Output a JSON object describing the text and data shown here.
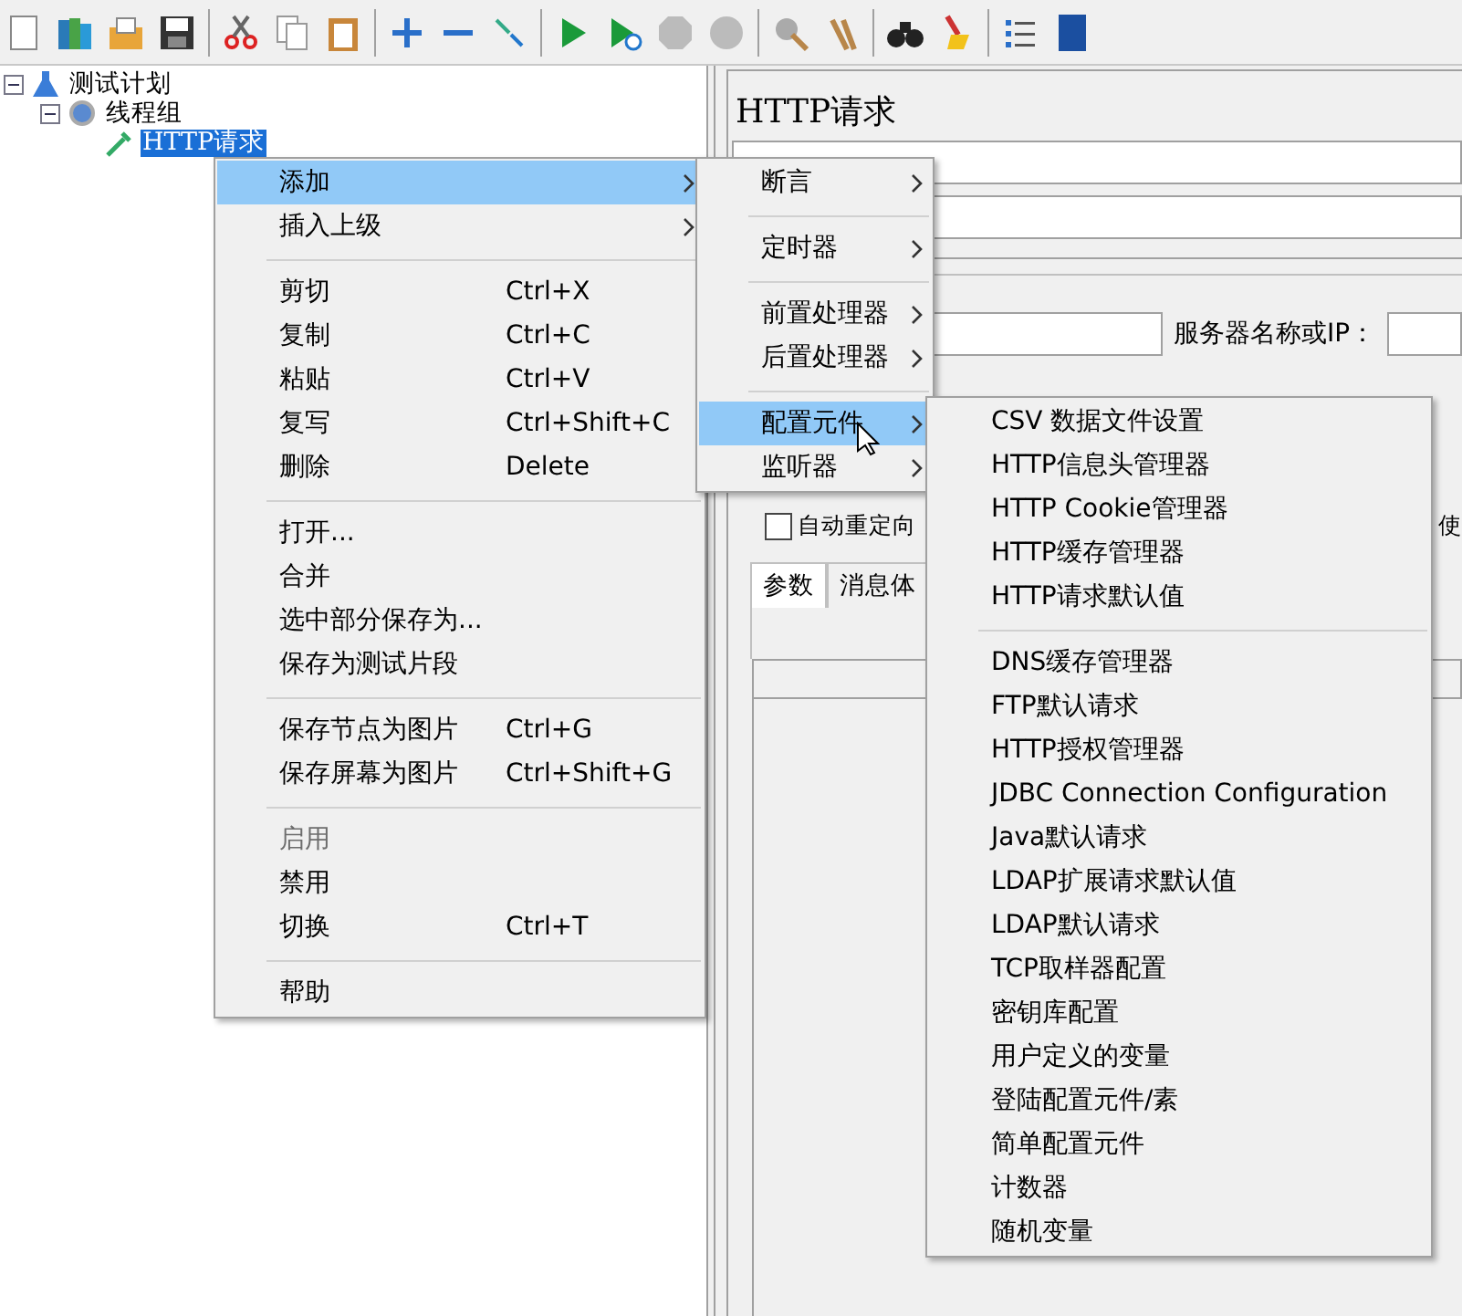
{
  "tree": [
    {
      "label": "测试计划",
      "expanded": true,
      "selected": false,
      "children": [
        {
          "label": "线程组",
          "expanded": true,
          "selected": false,
          "children": [
            {
              "label": "HTTP请求",
              "selected": true
            }
          ]
        }
      ]
    }
  ],
  "panel": {
    "title": "HTTP请求",
    "server_label": "服务器名称或IP：",
    "redirect": {
      "label": "自动重定向",
      "checked": false
    },
    "cut_label": "使",
    "tabs": [
      {
        "label": "参数",
        "selected": true
      },
      {
        "label": "消息体",
        "selected": false
      }
    ]
  },
  "context_menu": [
    {
      "kind": "item",
      "label": "添加",
      "submenu": true,
      "selected": true,
      "disabled": false
    },
    {
      "kind": "item",
      "label": "插入上级",
      "submenu": true,
      "selected": false,
      "disabled": false
    },
    {
      "kind": "separator"
    },
    {
      "kind": "item",
      "label": "剪切",
      "shortcut": "Ctrl+X",
      "selected": false,
      "disabled": false
    },
    {
      "kind": "item",
      "label": "复制",
      "shortcut": "Ctrl+C",
      "selected": false,
      "disabled": false
    },
    {
      "kind": "item",
      "label": "粘贴",
      "shortcut": "Ctrl+V",
      "selected": false,
      "disabled": false
    },
    {
      "kind": "item",
      "label": "复写",
      "shortcut": "Ctrl+Shift+C",
      "selected": false,
      "disabled": false
    },
    {
      "kind": "item",
      "label": "删除",
      "shortcut": "Delete",
      "selected": false,
      "disabled": false
    },
    {
      "kind": "separator"
    },
    {
      "kind": "item",
      "label": "打开...",
      "selected": false,
      "disabled": false
    },
    {
      "kind": "item",
      "label": "合并",
      "selected": false,
      "disabled": false
    },
    {
      "kind": "item",
      "label": "选中部分保存为...",
      "selected": false,
      "disabled": false
    },
    {
      "kind": "item",
      "label": "保存为测试片段",
      "selected": false,
      "disabled": false
    },
    {
      "kind": "separator"
    },
    {
      "kind": "item",
      "label": "保存节点为图片",
      "shortcut": "Ctrl+G",
      "selected": false,
      "disabled": false
    },
    {
      "kind": "item",
      "label": "保存屏幕为图片",
      "shortcut": "Ctrl+Shift+G",
      "selected": false,
      "disabled": false
    },
    {
      "kind": "separator"
    },
    {
      "kind": "item",
      "label": "启用",
      "selected": false,
      "disabled": true
    },
    {
      "kind": "item",
      "label": "禁用",
      "selected": false,
      "disabled": false
    },
    {
      "kind": "item",
      "label": "切换",
      "shortcut": "Ctrl+T",
      "selected": false,
      "disabled": false
    },
    {
      "kind": "separator"
    },
    {
      "kind": "item",
      "label": "帮助",
      "selected": false,
      "disabled": false
    }
  ],
  "add_submenu": [
    {
      "kind": "item",
      "label": "断言",
      "submenu": true,
      "selected": false
    },
    {
      "kind": "separator"
    },
    {
      "kind": "item",
      "label": "定时器",
      "submenu": true,
      "selected": false
    },
    {
      "kind": "separator"
    },
    {
      "kind": "item",
      "label": "前置处理器",
      "submenu": true,
      "selected": false
    },
    {
      "kind": "item",
      "label": "后置处理器",
      "submenu": true,
      "selected": false
    },
    {
      "kind": "separator"
    },
    {
      "kind": "item",
      "label": "配置元件",
      "submenu": true,
      "selected": true
    },
    {
      "kind": "item",
      "label": "监听器",
      "submenu": true,
      "selected": false
    }
  ],
  "config_submenu": [
    {
      "kind": "item",
      "label": "CSV 数据文件设置",
      "selected": false
    },
    {
      "kind": "item",
      "label": "HTTP信息头管理器",
      "selected": false
    },
    {
      "kind": "item",
      "label": "HTTP Cookie管理器",
      "selected": false
    },
    {
      "kind": "item",
      "label": "HTTP缓存管理器",
      "selected": false
    },
    {
      "kind": "item",
      "label": "HTTP请求默认值",
      "selected": false
    },
    {
      "kind": "separator"
    },
    {
      "kind": "item",
      "label": "DNS缓存管理器",
      "selected": false
    },
    {
      "kind": "item",
      "label": "FTP默认请求",
      "selected": false
    },
    {
      "kind": "item",
      "label": "HTTP授权管理器",
      "selected": false
    },
    {
      "kind": "item",
      "label": "JDBC Connection Configuration",
      "selected": false
    },
    {
      "kind": "item",
      "label": "Java默认请求",
      "selected": false
    },
    {
      "kind": "item",
      "label": "LDAP扩展请求默认值",
      "selected": false
    },
    {
      "kind": "item",
      "label": "LDAP默认请求",
      "selected": false
    },
    {
      "kind": "item",
      "label": "TCP取样器配置",
      "selected": false
    },
    {
      "kind": "item",
      "label": "密钥库配置",
      "selected": false
    },
    {
      "kind": "item",
      "label": "用户定义的变量",
      "selected": false
    },
    {
      "kind": "item",
      "label": "登陆配置元件/素",
      "selected": false
    },
    {
      "kind": "item",
      "label": "简单配置元件",
      "selected": false
    },
    {
      "kind": "item",
      "label": "计数器",
      "selected": false
    },
    {
      "kind": "item",
      "label": "随机变量",
      "selected": false
    }
  ]
}
